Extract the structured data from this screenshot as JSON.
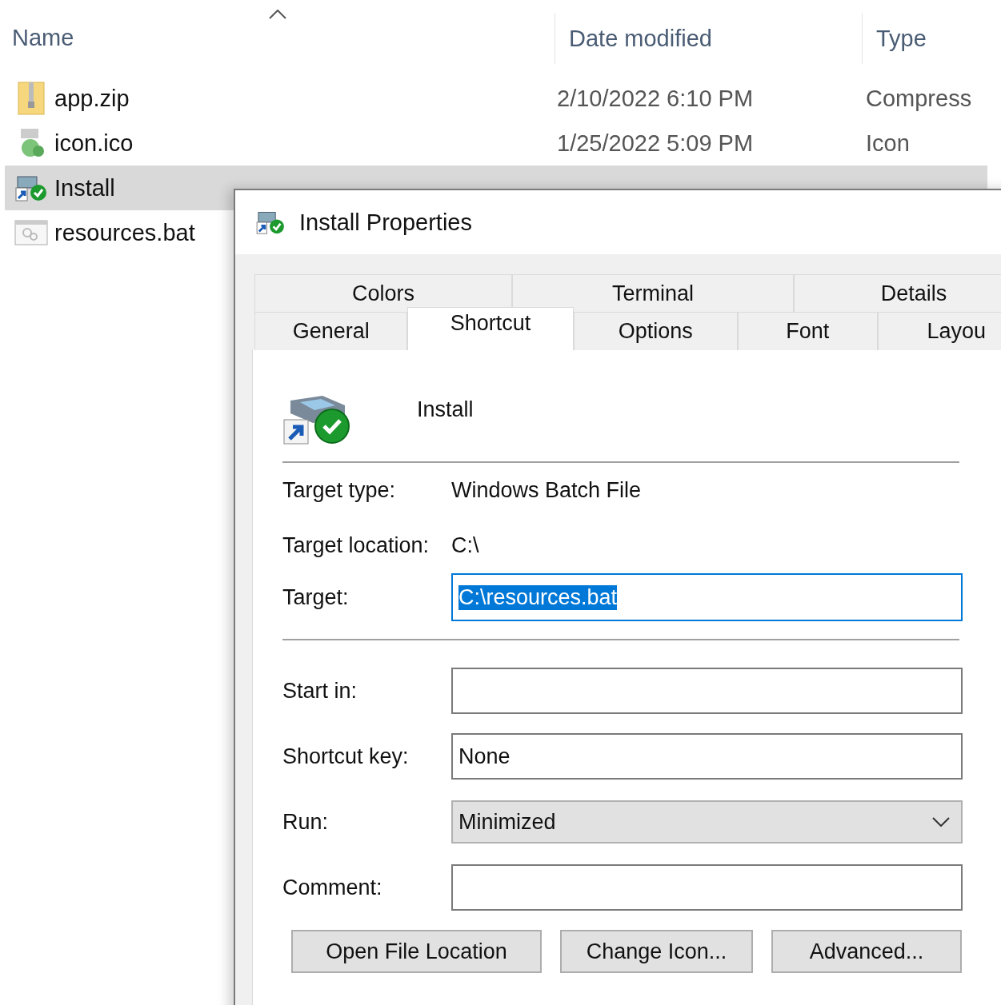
{
  "explorer": {
    "columns": [
      {
        "label": "Name",
        "sorted": true
      },
      {
        "label": "Date modified",
        "sorted": false
      },
      {
        "label": "Type",
        "sorted": false
      }
    ],
    "files": [
      {
        "name": "app.zip",
        "kind": "zip",
        "date": "2/10/2022 6:10 PM",
        "type": "Compress",
        "selected": false
      },
      {
        "name": "icon.ico",
        "kind": "ico",
        "date": "1/25/2022 5:09 PM",
        "type": "Icon",
        "selected": false
      },
      {
        "name": "Install",
        "kind": "shortcut",
        "selected": true
      },
      {
        "name": "resources.bat",
        "kind": "bat",
        "selected": false
      }
    ]
  },
  "dialog": {
    "title": "Install Properties",
    "tab_rows": [
      [
        {
          "label": "Colors",
          "selected": false
        },
        {
          "label": "Terminal",
          "selected": false
        },
        {
          "label": "Details",
          "selected": false
        }
      ],
      [
        {
          "label": "General",
          "selected": false
        },
        {
          "label": "Shortcut",
          "selected": true
        },
        {
          "label": "Options",
          "selected": false
        },
        {
          "label": "Font",
          "selected": false
        },
        {
          "label": "Layou",
          "selected": false
        }
      ]
    ],
    "shortcut_name": "Install",
    "info": [
      {
        "label": "Target type:",
        "value": "Windows Batch File"
      },
      {
        "label": "Target location:",
        "value": "C:\\"
      }
    ],
    "target": {
      "label": "Target:",
      "value": "C:\\resources.bat",
      "focused": true
    },
    "fields": [
      {
        "label": "Start in:",
        "kind": "text"
      },
      {
        "label": "Shortcut key:",
        "kind": "text",
        "value": "None"
      },
      {
        "label": "Run:",
        "kind": "dropdown",
        "value": "Minimized"
      },
      {
        "label": "Comment:",
        "kind": "text"
      }
    ],
    "buttons": [
      "Open File Location",
      "Change Icon...",
      "Advanced..."
    ]
  }
}
